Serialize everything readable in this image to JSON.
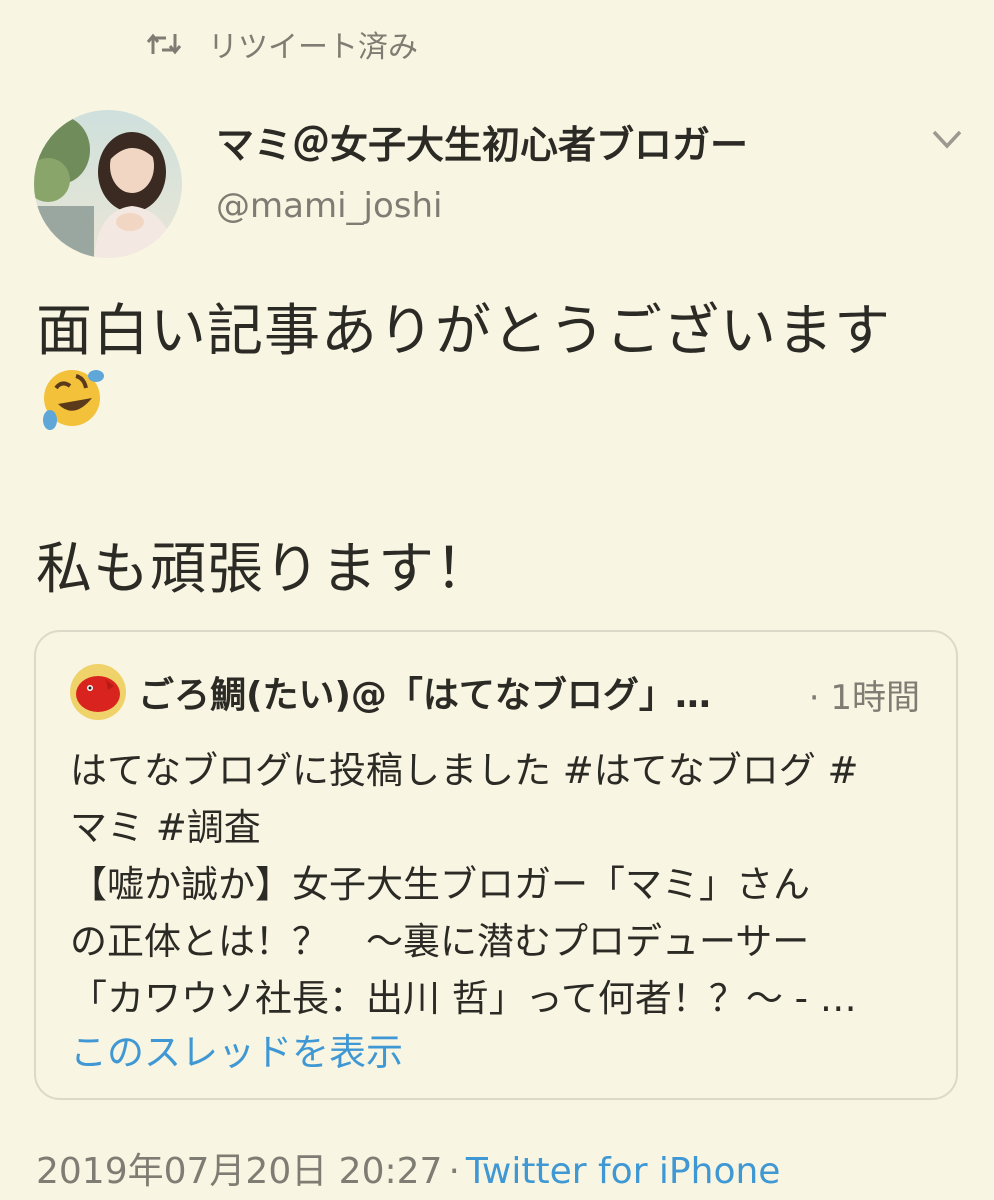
{
  "retweet": {
    "icon": "retweet-icon",
    "label": "リツイート済み"
  },
  "author": {
    "avatar": "profile-photo",
    "name": "マミ＠女子大生初心者ブロガー",
    "handle": "@mami_joshi"
  },
  "tweet": {
    "lines": [
      "面白い記事ありがとうございます",
      "私も頑張ります！"
    ],
    "emoji": "rolling-on-the-floor-laughing-emoji"
  },
  "quote": {
    "avatar": "red-sea-bream-avatar",
    "name": "ごろ鯛(たい)@「はてなブログ」…",
    "time": "· 1時間",
    "lines": [
      "はてなブログに投稿しました #はてなブログ #",
      "マミ #調査",
      "【嘘か誠か】女子大生ブロガー「マミ」さん",
      "の正体とは！？　～裏に潜むプロデューサー",
      "「カワウソ社長：出川 哲」って何者！？～ - …"
    ],
    "link": "このスレッドを表示"
  },
  "footer": {
    "timestamp": "2019年07月20日 20:27",
    "separator": "·",
    "client": "Twitter for iPhone"
  },
  "colors": {
    "background": "#f8f5e2",
    "text": "#2b2a25",
    "muted": "#7f7d73",
    "link": "#3f98d4",
    "border": "#dcd9c8"
  }
}
